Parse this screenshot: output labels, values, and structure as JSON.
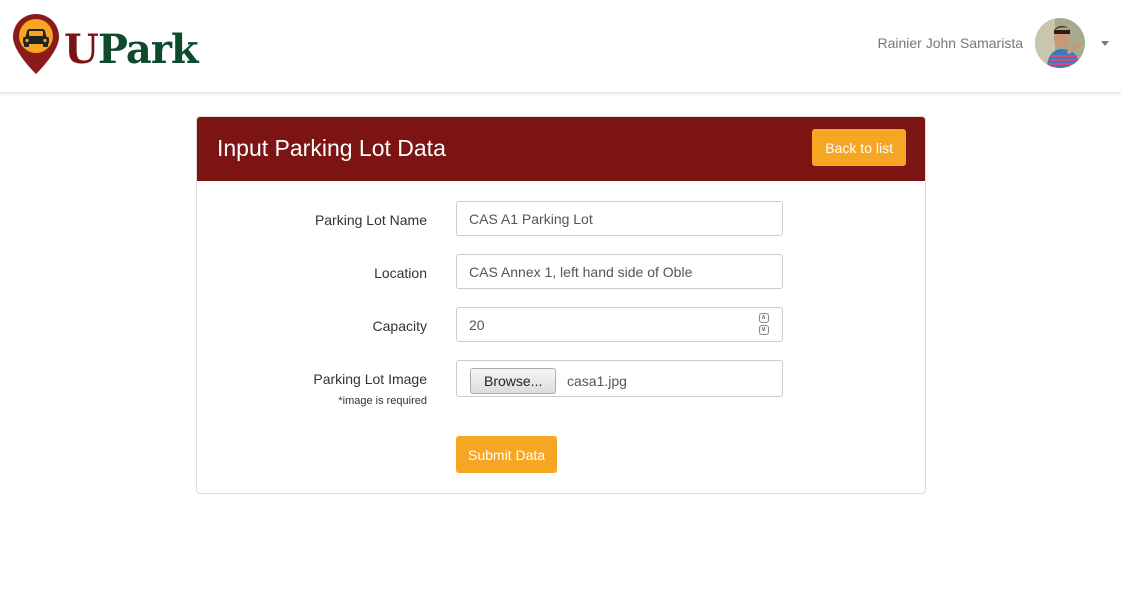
{
  "app": {
    "logo_u": "U",
    "logo_park": "Park"
  },
  "user": {
    "name": "Rainier John Samarista"
  },
  "form": {
    "title": "Input Parking Lot Data",
    "back_label": "Back to list",
    "fields": {
      "name": {
        "label": "Parking Lot Name",
        "value": "CAS A1 Parking Lot"
      },
      "location": {
        "label": "Location",
        "value": "CAS Annex 1, left hand side of Oble"
      },
      "capacity": {
        "label": "Capacity",
        "value": "20"
      },
      "image": {
        "label": "Parking Lot Image",
        "note": "*image is required",
        "browse_label": "Browse...",
        "file_name": "casa1.jpg"
      }
    },
    "submit_label": "Submit Data"
  },
  "colors": {
    "primary": "#7d1414",
    "accent": "#f5a623",
    "logo_green": "#0f4a2c"
  },
  "icons": {
    "logo": "map-pin-car-icon",
    "user_menu": "caret-down-icon",
    "spinner_up": "chevron-up-icon",
    "spinner_down": "chevron-down-icon"
  }
}
